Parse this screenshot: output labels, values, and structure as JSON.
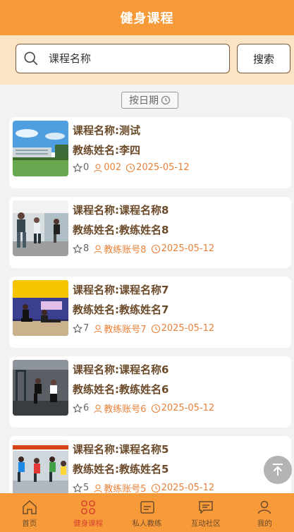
{
  "header": {
    "title": "健身课程"
  },
  "search": {
    "placeholder": "课程名称",
    "button_label": "搜索"
  },
  "sort": {
    "label": "按日期"
  },
  "courses": [
    {
      "title": "课程名称:测试",
      "coach": "教练姓名:李四",
      "favorites": "0",
      "account": "002",
      "date": "2025-05-12"
    },
    {
      "title": "课程名称:课程名称8",
      "coach": "教练姓名:教练姓名8",
      "favorites": "8",
      "account": "教练账号8",
      "date": "2025-05-12"
    },
    {
      "title": "课程名称:课程名称7",
      "coach": "教练姓名:教练姓名7",
      "favorites": "7",
      "account": "教练账号7",
      "date": "2025-05-12"
    },
    {
      "title": "课程名称:课程名称6",
      "coach": "教练姓名:教练姓名6",
      "favorites": "6",
      "account": "教练账号6",
      "date": "2025-05-12"
    },
    {
      "title": "课程名称:课程名称5",
      "coach": "教练姓名:教练姓名5",
      "favorites": "5",
      "account": "教练账号5",
      "date": "2025-05-12"
    }
  ],
  "tabs": [
    {
      "label": "首页",
      "icon": "home-icon",
      "active": false
    },
    {
      "label": "健身课程",
      "icon": "course-icon",
      "active": true
    },
    {
      "label": "私人教练",
      "icon": "trainer-icon",
      "active": false
    },
    {
      "label": "互动社区",
      "icon": "community-icon",
      "active": false
    },
    {
      "label": "我的",
      "icon": "user-icon",
      "active": false
    }
  ],
  "colors": {
    "primary": "#f79a3a",
    "search_bg": "#fbe4c4",
    "text_brown": "#6b4a2a",
    "active_tab": "#d6432f",
    "accent": "#e9813a"
  }
}
